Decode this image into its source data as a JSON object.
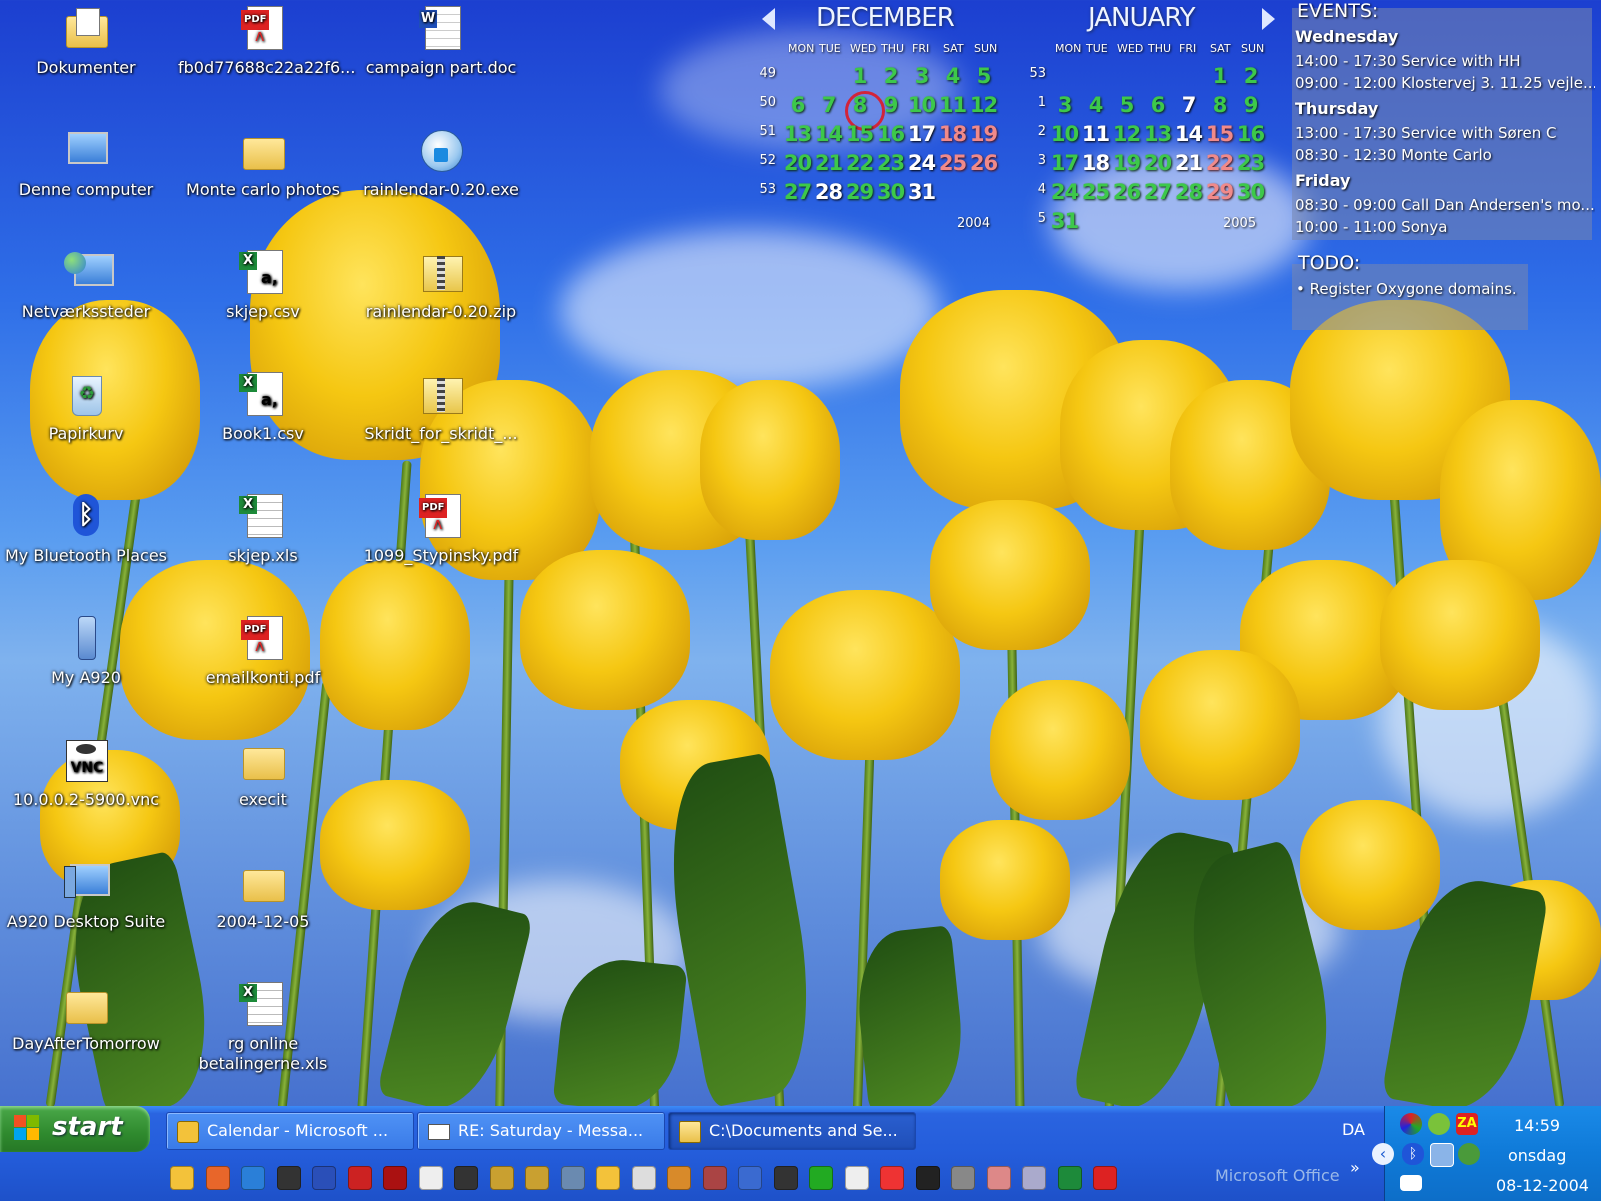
{
  "desktop": {
    "icons": [
      {
        "label": "Dokumenter",
        "icon": "folder-documents-icon"
      },
      {
        "label": "fb0d77688c22a22f6...",
        "icon": "pdf-icon"
      },
      {
        "label": "campaign part.doc",
        "icon": "word-doc-icon"
      },
      {
        "label": "Denne computer",
        "icon": "computer-icon"
      },
      {
        "label": "Monte carlo photos",
        "icon": "folder-icon"
      },
      {
        "label": "rainlendar-0.20.exe",
        "icon": "installer-icon"
      },
      {
        "label": "Netværkssteder",
        "icon": "network-icon"
      },
      {
        "label": "skjep.csv",
        "icon": "csv-icon"
      },
      {
        "label": "rainlendar-0.20.zip",
        "icon": "zip-icon"
      },
      {
        "label": "Papirkurv",
        "icon": "recycle-bin-icon"
      },
      {
        "label": "Book1.csv",
        "icon": "csv-icon"
      },
      {
        "label": "Skridt_for_skridt_...",
        "icon": "zip-icon"
      },
      {
        "label": "My Bluetooth Places",
        "icon": "bluetooth-icon"
      },
      {
        "label": "skjep.xls",
        "icon": "excel-icon"
      },
      {
        "label": "1099_Stypinsky.pdf",
        "icon": "pdf-icon"
      },
      {
        "label": "My A920",
        "icon": "phone-icon"
      },
      {
        "label": "emailkonti.pdf",
        "icon": "pdf-icon"
      },
      {
        "label": "10.0.0.2-5900.vnc",
        "icon": "vnc-icon"
      },
      {
        "label": "execit",
        "icon": "folder-icon"
      },
      {
        "label": "A920 Desktop Suite",
        "icon": "desktop-suite-icon"
      },
      {
        "label": "2004-12-05",
        "icon": "folder-icon"
      },
      {
        "label": "DayAfterTomorrow",
        "icon": "folder-icon"
      },
      {
        "label": "rg online betalingerne.xls",
        "icon": "excel-icon"
      }
    ]
  },
  "calendar": {
    "prev_label": "previous-month-icon",
    "next_label": "next-month-icon",
    "weekdays": [
      "MON",
      "TUE",
      "WED",
      "THU",
      "FRI",
      "SAT",
      "SUN"
    ],
    "months": [
      {
        "name": "DECEMBER",
        "year": "2004",
        "weeks": [
          "49",
          "50",
          "51",
          "52",
          "53"
        ],
        "rows": [
          [
            "",
            "",
            "1",
            "2",
            "3",
            "4",
            "5"
          ],
          [
            "6",
            "7",
            "8",
            "9",
            "10",
            "11",
            "12"
          ],
          [
            "13",
            "14",
            "15",
            "16",
            "17",
            "18",
            "19"
          ],
          [
            "20",
            "21",
            "22",
            "23",
            "24",
            "25",
            "26"
          ],
          [
            "27",
            "28",
            "29",
            "30",
            "31",
            "",
            ""
          ]
        ],
        "today": "8"
      },
      {
        "name": "JANUARY",
        "year": "2005",
        "weeks": [
          "53",
          "1",
          "2",
          "3",
          "4",
          "5"
        ],
        "rows": [
          [
            "",
            "",
            "",
            "",
            "",
            "1",
            "2"
          ],
          [
            "3",
            "4",
            "5",
            "6",
            "7",
            "8",
            "9"
          ],
          [
            "10",
            "11",
            "12",
            "13",
            "14",
            "15",
            "16"
          ],
          [
            "17",
            "18",
            "19",
            "20",
            "21",
            "22",
            "23"
          ],
          [
            "24",
            "25",
            "26",
            "27",
            "28",
            "29",
            "30"
          ],
          [
            "31",
            "",
            "",
            "",
            "",
            "",
            ""
          ]
        ]
      }
    ]
  },
  "events": {
    "title": "EVENTS:",
    "groups": [
      {
        "day": "Wednesday",
        "items": [
          "14:00 - 17:30 Service with HH",
          "09:00 - 12:00 Klostervej 3. 11.25 vejle..."
        ]
      },
      {
        "day": "Thursday",
        "items": [
          "13:00 - 17:30 Service with Søren C",
          "08:30 - 12:30 Monte Carlo"
        ]
      },
      {
        "day": "Friday",
        "items": [
          "08:30 - 09:00 Call Dan Andersen's mo...",
          "10:00 - 11:00 Sonya"
        ]
      }
    ]
  },
  "todo": {
    "title": "TODO:",
    "items": [
      "Register Oxygone domains."
    ]
  },
  "taskbar": {
    "start_label": "start",
    "windows": [
      {
        "label": "Calendar - Microsoft ...",
        "icon": "outlook-calendar-icon"
      },
      {
        "label": "RE: Saturday - Messa...",
        "icon": "mail-message-icon"
      },
      {
        "label": "C:\\Documents and Se...",
        "icon": "explorer-folder-icon"
      }
    ],
    "language": "DA",
    "toolbar_label": "Microsoft Office",
    "chevron": "»",
    "clock_time": "14:59",
    "clock_day": "onsdag",
    "clock_date": "08-12-2004",
    "quick_launch": [
      "outlook-icon",
      "firefox-icon",
      "internet-explorer-icon",
      "vnc-viewer-icon",
      "word-icon",
      "powerpoint-icon",
      "pdf-tool-icon",
      "media-player-icon",
      "vnc-icon",
      "winzip-icon",
      "winzip-self-extract-icon",
      "network-tool-icon",
      "rainlendar-icon",
      "cd-icon",
      "clock-icon",
      "game-icon",
      "headset-icon",
      "walker-icon",
      "radioactive-icon",
      "card-icon",
      "firewall-icon",
      "h-icon",
      "crosshair-icon",
      "paint-icon",
      "notepad-icon",
      "excel-icon",
      "antivirus-icon"
    ],
    "tray_icons": [
      "sync-icon",
      "update-icon",
      "zonealarm-icon",
      "collapse-icon",
      "bluetooth-tray-icon",
      "network-tray-icon",
      "users-tray-icon",
      "mail-tray-icon"
    ]
  }
}
